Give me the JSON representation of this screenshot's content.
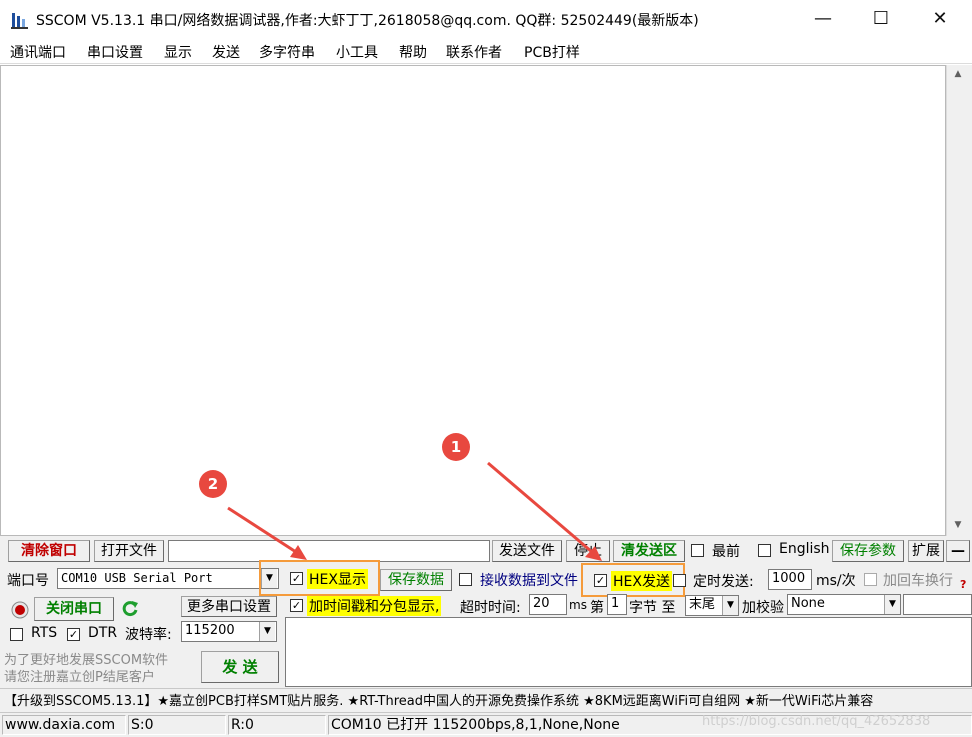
{
  "window": {
    "title": "SSCOM V5.13.1 串口/网络数据调试器,作者:大虾丁丁,2618058@qq.com. QQ群: 52502449(最新版本)",
    "minimize": "—",
    "maximize": "☐",
    "close": "✕"
  },
  "menu": [
    "通讯端口",
    "串口设置",
    "显示",
    "发送",
    "多字符串",
    "小工具",
    "帮助",
    "联系作者",
    "PCB打样"
  ],
  "toolbar": {
    "clear_window": "清除窗口",
    "open_file": "打开文件",
    "file_path": "",
    "send_file": "发送文件",
    "stop": "停止",
    "clear_send": "清发送区",
    "topmost": "最前",
    "english": "English",
    "save_params": "保存参数",
    "expand": "扩展",
    "collapse": "—"
  },
  "port": {
    "label": "端口号",
    "value": "COM10 USB Serial Port",
    "close_port": "关闭串口",
    "more_settings": "更多串口设置",
    "rts": "RTS",
    "dtr": "DTR",
    "baud_label": "波特率:",
    "baud_value": "115200",
    "rts_checked": false,
    "dtr_checked": true
  },
  "options": {
    "hex_display": "HEX显示",
    "hex_display_checked": true,
    "save_data": "保存数据",
    "recv_to_file": "接收数据到文件",
    "recv_to_file_checked": false,
    "hex_send": "HEX发送",
    "hex_send_checked": true,
    "timed_send": "定时发送:",
    "timed_send_checked": false,
    "timed_value": "1000",
    "timed_unit": "ms/次",
    "add_crlf": "加回车换行",
    "add_timestamp": "加时间戳和分包显示,",
    "add_timestamp_checked": true,
    "timeout_label": "超时时间:",
    "timeout_value": "20",
    "timeout_unit": "ms",
    "nth_label": "第",
    "nth_value": "1",
    "byte_label": "字节 至",
    "tail_value": "末尾",
    "checksum_label": "加校验",
    "checksum_value": "None"
  },
  "promo": {
    "line1": "为了更好地发展SSCOM软件",
    "line2": "请您注册嘉立创P结尾客户",
    "send": "发 送"
  },
  "annotations": {
    "badge1": "1",
    "badge2": "2"
  },
  "adbar": "【升级到SSCOM5.13.1】★嘉立创PCB打样SMT贴片服务. ★RT-Thread中国人的开源免费操作系统 ★8KM远距离WiFi可自组网 ★新一代WiFi芯片兼容",
  "status": {
    "site": "www.daxia.com",
    "sent": "S:0",
    "recv": "R:0",
    "port_status": "COM10 已打开  115200bps,8,1,None,None",
    "watermark": "https://blog.csdn.net/qq_42652838"
  },
  "colors": {
    "clear_window_text": "#c00000",
    "green_text": "#008000",
    "blue_text": "#000080",
    "highlight": "#ffff00",
    "annotation_box": "#f59b3b",
    "badge": "#e8483f"
  },
  "icons": [
    "app-icon",
    "record-icon",
    "refresh-icon"
  ]
}
